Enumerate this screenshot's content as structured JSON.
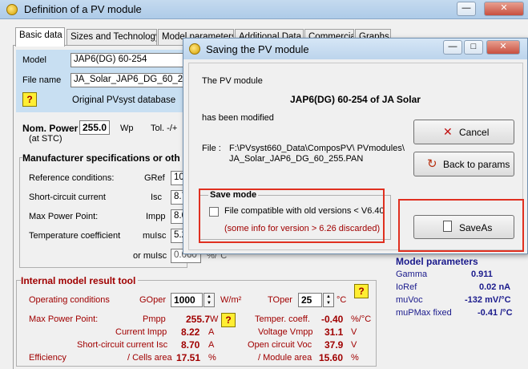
{
  "main_window": {
    "title": "Definition of a PV module",
    "minimize_glyph": "—",
    "close_glyph": "✕"
  },
  "tabs": [
    {
      "label": "Basic data",
      "active": true
    },
    {
      "label": "Sizes and Technology"
    },
    {
      "label": "Model parameters"
    },
    {
      "label": "Additional Data"
    },
    {
      "label": "Commercial"
    },
    {
      "label": "Graphs"
    }
  ],
  "model_info": {
    "model_label": "Model",
    "model_value": "JAP6(DG) 60-254",
    "file_label": "File name",
    "file_value": "JA_Solar_JAP6_DG_60_255",
    "help_glyph": "?",
    "database_text": "Original PVsyst database"
  },
  "nominal_power": {
    "label": "Nom. Power",
    "sublabel": "(at STC)",
    "value": "255.0",
    "unit": "Wp",
    "tol_label": "Tol. -/+"
  },
  "manufacturer": {
    "title": "Manufacturer specifications   or   oth",
    "rows": [
      {
        "label": "Reference conditions:",
        "symbol": "GRef",
        "value": "10"
      },
      {
        "label": "Short-circuit current",
        "symbol": "Isc",
        "value": "8.7"
      },
      {
        "label": "Max Power Point:",
        "symbol": "Impp",
        "value": "8.0"
      },
      {
        "label": "Temperature coefficient",
        "symbol": "muIsc",
        "value": "5.2"
      }
    ],
    "or_muisc_label": "or muIsc",
    "or_muisc_value": "0.060",
    "or_muisc_unit": "%/°C"
  },
  "model_params": {
    "title": "Model parameters",
    "rows": [
      {
        "label": "Gamma",
        "value": "0.911"
      },
      {
        "label": "IoRef",
        "value": "0.02 nA"
      },
      {
        "label": "muVoc",
        "value": "-132 mV/°C"
      },
      {
        "label": "muPMax fixed",
        "value": "-0.41 /°C"
      }
    ]
  },
  "internal_tool": {
    "title": "Internal model result tool",
    "operating_label": "Operating conditions",
    "goper_label": "GOper",
    "goper_value": "1000",
    "goper_unit": "W/m²",
    "toper_label": "TOper",
    "toper_value": "25",
    "toper_unit": "°C",
    "mpp_label": "Max Power Point:",
    "pmpp_label": "Pmpp",
    "pmpp_value": "255.7",
    "pmpp_unit": "W",
    "temper_label": "Temper. coeff.",
    "temper_value": "-0.40",
    "temper_unit": "%/°C",
    "current_impp_label": "Current Impp",
    "current_impp_value": "8.22",
    "current_impp_unit": "A",
    "voltage_vmpp_label": "Voltage Vmpp",
    "voltage_vmpp_value": "31.1",
    "voltage_vmpp_unit": "V",
    "short_circuit_label": "Short-circuit current Isc",
    "short_circuit_value": "8.70",
    "short_circuit_unit": "A",
    "open_circuit_label": "Open circuit Voc",
    "open_circuit_value": "37.9",
    "open_circuit_unit": "V",
    "efficiency_label": "Efficiency",
    "cells_area_label": "/ Cells area",
    "cells_area_value": "17.51",
    "cells_area_unit": "%",
    "module_area_label": "/ Module area",
    "module_area_value": "15.60",
    "module_area_unit": "%"
  },
  "dialog": {
    "title": "Saving  the PV module",
    "intro": "The PV module",
    "module_name": "JAP6(DG) 60-254   of   JA Solar",
    "modified": "has been modified",
    "file_label": "File :",
    "file_path_line1": "F:\\PVsyst660_Data\\ComposPV\\ PVmodules\\",
    "file_path_line2": "JA_Solar_JAP6_DG_60_255.PAN",
    "cancel_label": "Cancel",
    "back_label": "Back to params",
    "save_mode_title": "Save mode",
    "compat_label": "File compatible with old versions < V6.40",
    "compat_note": "(some info for version > 6.26 discarded)",
    "saveas_label": "SaveAs",
    "minimize_glyph": "—",
    "maximize_glyph": "□",
    "close_glyph": "✕"
  },
  "colors": {
    "accent_red": "#e03020",
    "help_yellow": "#ffee33"
  }
}
